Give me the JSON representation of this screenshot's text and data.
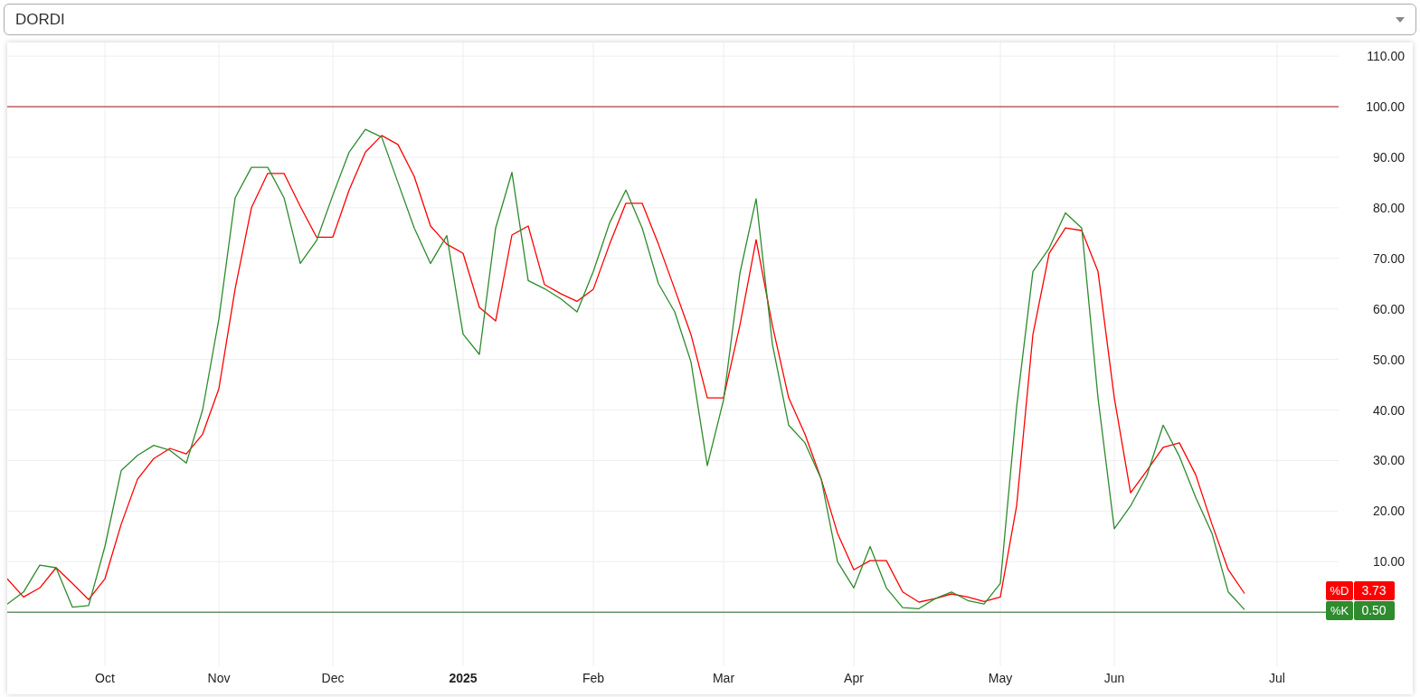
{
  "selector": {
    "value": "DORDI"
  },
  "chart": {
    "price_tags": [
      {
        "value": "3.73"
      },
      {
        "value": "0.50"
      }
    ],
    "chart_data": {
      "type": "line",
      "ylim": [
        -10.7,
        112.7
      ],
      "categories": [
        null,
        null,
        null,
        null,
        null,
        null,
        "Oct",
        null,
        null,
        null,
        null,
        null,
        null,
        "Nov",
        null,
        null,
        null,
        null,
        null,
        null,
        "Dec",
        null,
        null,
        null,
        null,
        null,
        null,
        null,
        "2025",
        null,
        null,
        null,
        null,
        null,
        null,
        null,
        "Feb",
        null,
        null,
        null,
        null,
        null,
        null,
        null,
        "Mar",
        null,
        null,
        null,
        null,
        null,
        null,
        null,
        "Apr",
        null,
        null,
        null,
        null,
        null,
        null,
        null,
        null,
        "May",
        null,
        null,
        null,
        null,
        null,
        null,
        "Jun",
        null,
        null,
        null,
        null,
        null,
        null,
        null,
        null,
        null,
        "Jul",
        null,
        null
      ],
      "yticks": [
        {
          "value": 10,
          "label": "10.00"
        },
        {
          "value": 20,
          "label": "20.00"
        },
        {
          "value": 30,
          "label": "30.00"
        },
        {
          "value": 40,
          "label": "40.00"
        },
        {
          "value": 50,
          "label": "50.00"
        },
        {
          "value": 60,
          "label": "60.00"
        },
        {
          "value": 70,
          "label": "70.00"
        },
        {
          "value": 80,
          "label": "80.00"
        },
        {
          "value": 90,
          "label": "90.00"
        },
        {
          "value": 100,
          "label": "100.00"
        },
        {
          "value": 110,
          "label": "110.00"
        }
      ],
      "series": [
        {
          "name": "%D",
          "color": "#ff0000",
          "values": [
            6.6,
            3,
            4.8,
            8.8,
            5.7,
            2.5,
            6.6,
            17.4,
            26.3,
            30.4,
            32.4,
            31.3,
            35.2,
            44.2,
            64,
            80,
            86.8,
            86.8,
            80.3,
            74.2,
            74.2,
            83.5,
            91,
            94.3,
            92.5,
            86.2,
            76.4,
            72.8,
            71,
            60.3,
            57.6,
            74.6,
            76.4,
            64.8,
            63,
            61.5,
            63.9,
            72.8,
            80.9,
            80.9,
            72.8,
            63.9,
            54.9,
            42.4,
            42.4,
            56.7,
            73.7,
            56.7,
            42.4,
            35.2,
            26.3,
            15.6,
            8.4,
            10.2,
            10.2,
            4,
            2,
            2.7,
            3.6,
            3,
            2.1,
            3,
            21,
            54.9,
            71,
            76,
            75.5,
            67.4,
            42.4,
            23.6,
            28,
            32.6,
            33.5,
            27.2,
            17.4,
            8.4,
            3.7,
            null,
            null,
            null,
            null
          ]
        },
        {
          "name": "%K",
          "color": "#2e8b2e",
          "values": [
            1.6,
            4,
            9.3,
            8.8,
            1,
            1.3,
            13,
            28,
            31,
            33,
            32,
            29.5,
            40,
            58,
            82,
            88,
            88,
            82,
            69,
            73.5,
            82.5,
            91,
            95.5,
            94,
            85,
            76,
            69,
            74.5,
            55,
            51,
            76,
            87,
            65.6,
            64,
            62,
            59.4,
            67.4,
            77,
            83.5,
            76,
            65,
            59.4,
            49.5,
            29,
            42,
            67,
            81.8,
            53,
            37,
            33.5,
            26.3,
            10,
            4.8,
            13,
            4.8,
            0.9,
            0.7,
            2.7,
            4,
            2.3,
            1.6,
            5.7,
            40.6,
            67.4,
            72,
            79,
            76,
            42.4,
            16.5,
            21,
            27,
            37,
            30.8,
            22.7,
            15.6,
            4,
            0.5,
            null,
            null,
            null,
            null
          ]
        }
      ],
      "ref_lines": [
        {
          "axis": "y",
          "value": 100,
          "color": "#a31515"
        },
        {
          "axis": "y",
          "value": 0,
          "color": "#1b5e20"
        }
      ],
      "grid": true,
      "legend": true
    }
  }
}
